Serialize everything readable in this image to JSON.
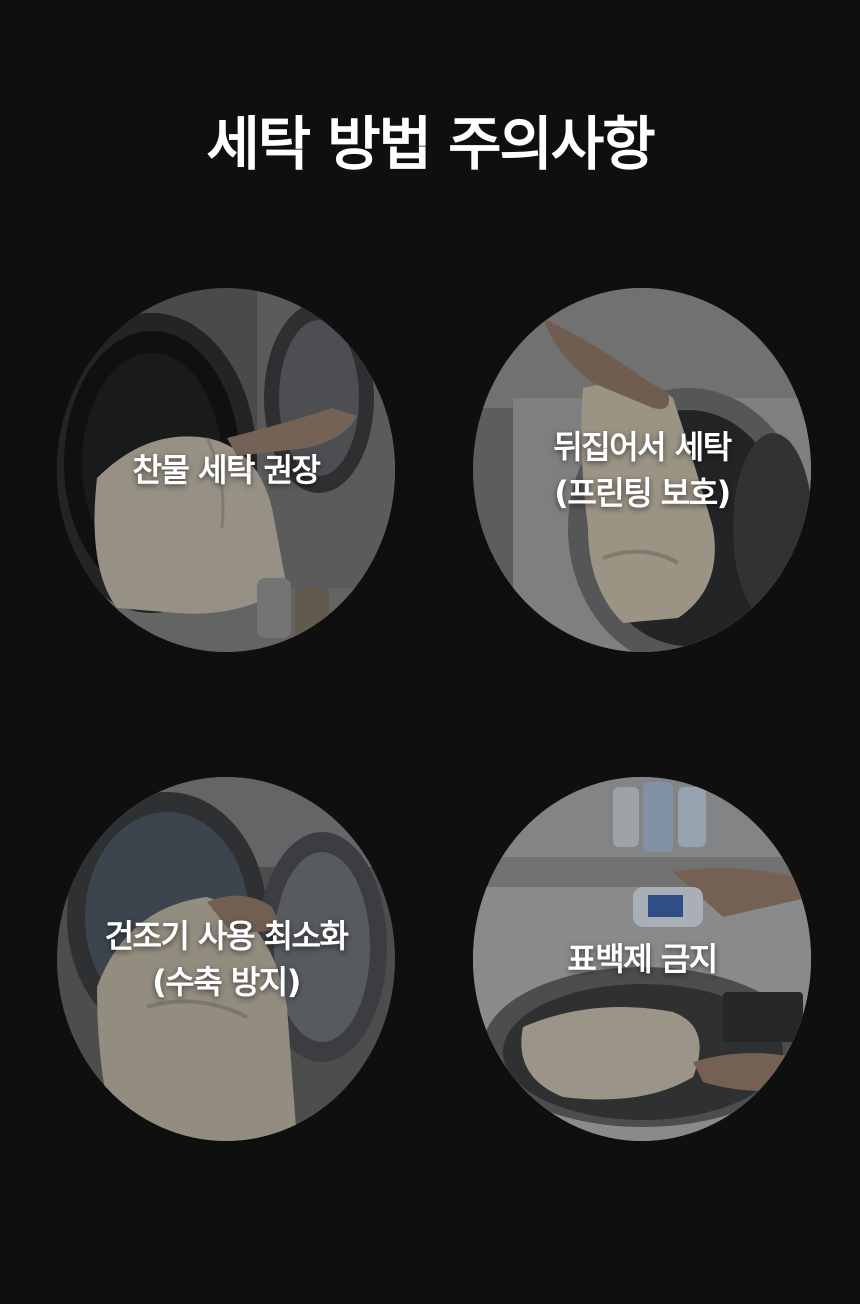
{
  "page": {
    "title": "세탁 방법 주의사항",
    "background_color": "#0f0f0f"
  },
  "cards": [
    {
      "lines": [
        "찬물 세탁 권장"
      ],
      "image": "washing-machine-cold-wash-photo"
    },
    {
      "lines": [
        "뒤집어서 세탁",
        "(프린팅 보호)"
      ],
      "image": "inside-out-garment-photo"
    },
    {
      "lines": [
        "건조기 사용 최소화",
        "(수축 방지)"
      ],
      "image": "dryer-garment-photo"
    },
    {
      "lines": [
        "표백제 금지"
      ],
      "image": "bleach-pouring-photo"
    }
  ]
}
